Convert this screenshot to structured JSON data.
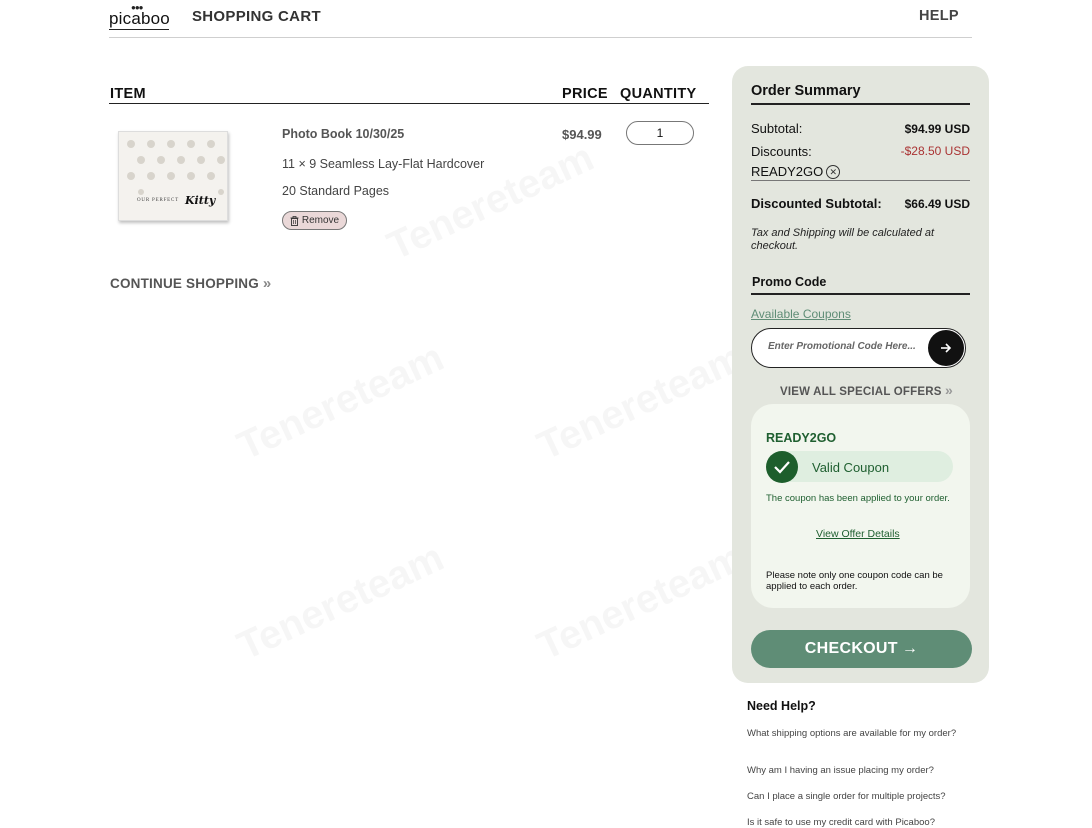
{
  "header": {
    "logo_text": "picaboo",
    "title": "SHOPPING CART",
    "help": "HELP"
  },
  "cart": {
    "columns": {
      "item": "ITEM",
      "price": "PRICE",
      "quantity": "QUANTITY"
    },
    "item": {
      "title": "Photo Book 10/30/25",
      "description": "11 × 9 Seamless Lay-Flat Hardcover",
      "pages": "20 Standard Pages",
      "remove_label": "Remove",
      "price": "$94.99",
      "quantity": "1",
      "thumbnail_caption": "OUR PERFECT",
      "thumbnail_script": "Kitty"
    },
    "continue_label": "CONTINUE SHOPPING"
  },
  "summary": {
    "title": "Order Summary",
    "subtotal_label": "Subtotal:",
    "subtotal_value": "$94.99 USD",
    "discounts_label": "Discounts:",
    "discounts_value": "-$28.50 USD",
    "applied_coupon": "READY2GO",
    "discounted_subtotal_label": "Discounted Subtotal:",
    "discounted_subtotal_value": "$66.49 USD",
    "tax_note": "Tax and Shipping will be calculated at checkout.",
    "promo_title": "Promo Code",
    "available_coupons": "Available Coupons",
    "promo_placeholder": "Enter Promotional Code Here...",
    "view_offers": "VIEW ALL SPECIAL OFFERS",
    "coupon_card": {
      "code": "READY2GO",
      "status": "Valid Coupon",
      "message": "The coupon has been applied to your order.",
      "details_link": "View Offer Details",
      "note": "Please note only one coupon code can be applied to each order."
    },
    "checkout_label": "CHECKOUT"
  },
  "help": {
    "title": "Need Help?",
    "faqs": [
      "What shipping options are available for my order?",
      "Why am I having an issue placing my order?",
      "Can I place a single order for multiple projects?",
      "Is it safe to use my credit card with Picaboo?"
    ]
  },
  "watermark": "Tenereteam",
  "colors": {
    "accent_green": "#5f8d76",
    "panel_bg": "#e3e6de",
    "discount_red": "#a33333",
    "valid_green": "#1d5e2c"
  }
}
